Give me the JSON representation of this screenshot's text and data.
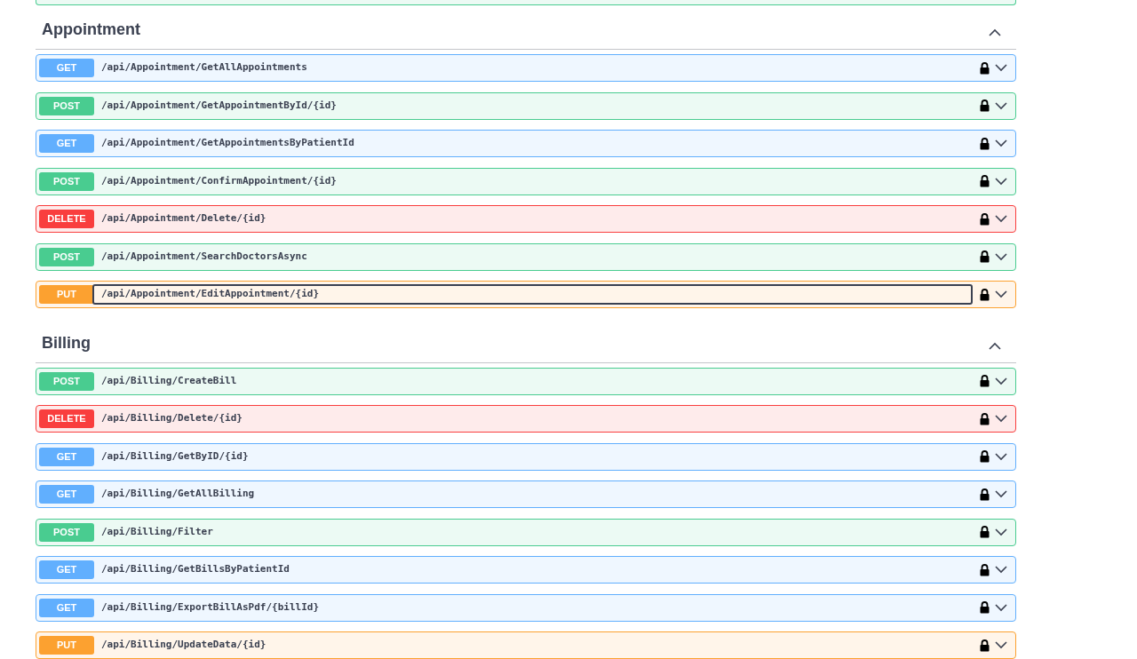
{
  "sections": [
    {
      "title": "Appointment",
      "expanded": true,
      "endpoints": [
        {
          "method": "GET",
          "path": "/api/Appointment/GetAllAppointments",
          "focused": false
        },
        {
          "method": "POST",
          "path": "/api/Appointment/GetAppointmentById/{id}",
          "focused": false
        },
        {
          "method": "GET",
          "path": "/api/Appointment/GetAppointmentsByPatientId",
          "focused": false
        },
        {
          "method": "POST",
          "path": "/api/Appointment/ConfirmAppointment/{id}",
          "focused": false
        },
        {
          "method": "DELETE",
          "path": "/api/Appointment/Delete/{id}",
          "focused": false
        },
        {
          "method": "POST",
          "path": "/api/Appointment/SearchDoctorsAsync",
          "focused": false
        },
        {
          "method": "PUT",
          "path": "/api/Appointment/EditAppointment/{id}",
          "focused": true
        }
      ]
    },
    {
      "title": "Billing",
      "expanded": true,
      "endpoints": [
        {
          "method": "POST",
          "path": "/api/Billing/CreateBill",
          "focused": false
        },
        {
          "method": "DELETE",
          "path": "/api/Billing/Delete/{id}",
          "focused": false
        },
        {
          "method": "GET",
          "path": "/api/Billing/GetByID/{id}",
          "focused": false
        },
        {
          "method": "GET",
          "path": "/api/Billing/GetAllBilling",
          "focused": false
        },
        {
          "method": "POST",
          "path": "/api/Billing/Filter",
          "focused": false
        },
        {
          "method": "GET",
          "path": "/api/Billing/GetBillsByPatientId",
          "focused": false
        },
        {
          "method": "GET",
          "path": "/api/Billing/ExportBillAsPdf/{billId}",
          "focused": false
        },
        {
          "method": "PUT",
          "path": "/api/Billing/UpdateData/{id}",
          "focused": false
        }
      ]
    }
  ]
}
